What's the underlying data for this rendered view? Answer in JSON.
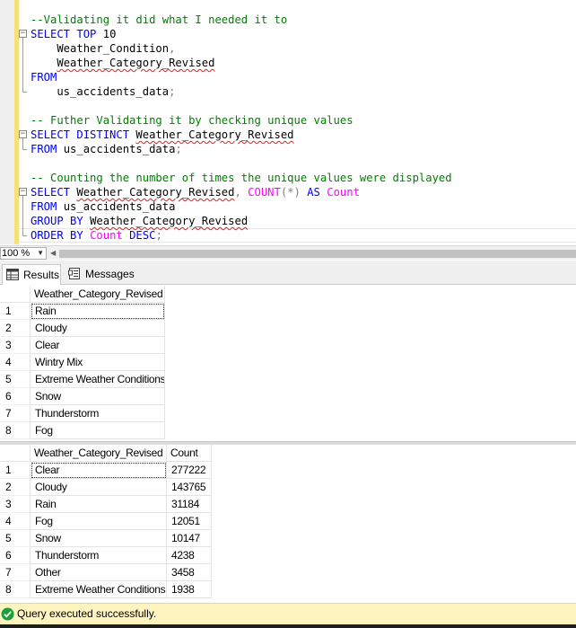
{
  "editor": {
    "lines": [
      {
        "segments": [
          {
            "t": "--Validating it did what I needed it to",
            "c": "cm"
          }
        ]
      },
      {
        "segments": [
          {
            "t": "SELECT",
            "c": "kw"
          },
          {
            "t": " "
          },
          {
            "t": "TOP",
            "c": "kw"
          },
          {
            "t": " 10"
          }
        ]
      },
      {
        "segments": [
          {
            "t": "    Weather_Condition"
          },
          {
            "t": ",",
            "c": "op"
          }
        ]
      },
      {
        "segments": [
          {
            "t": "    "
          },
          {
            "t": "Weather_Category_Revised",
            "c": "sq"
          }
        ]
      },
      {
        "segments": [
          {
            "t": "FROM",
            "c": "kw"
          }
        ]
      },
      {
        "segments": [
          {
            "t": "    us_accidents_data"
          },
          {
            "t": ";",
            "c": "op"
          }
        ]
      },
      {
        "segments": [
          {
            "t": ""
          }
        ]
      },
      {
        "segments": [
          {
            "t": "-- Futher Validating it by checking unique values",
            "c": "cm"
          }
        ]
      },
      {
        "segments": [
          {
            "t": "SELECT",
            "c": "kw"
          },
          {
            "t": " "
          },
          {
            "t": "DISTINCT",
            "c": "kw"
          },
          {
            "t": " "
          },
          {
            "t": "Weather_Category_Revised",
            "c": "sq"
          }
        ]
      },
      {
        "segments": [
          {
            "t": "FROM",
            "c": "kw"
          },
          {
            "t": " us_accidents_data"
          },
          {
            "t": ";",
            "c": "op"
          }
        ]
      },
      {
        "segments": [
          {
            "t": ""
          }
        ]
      },
      {
        "segments": [
          {
            "t": "-- Counting the number of times the unique values were displayed",
            "c": "cm"
          }
        ]
      },
      {
        "segments": [
          {
            "t": "SELECT",
            "c": "kw"
          },
          {
            "t": " "
          },
          {
            "t": "Weather_Category_Revised",
            "c": "sq"
          },
          {
            "t": ",",
            "c": "op"
          },
          {
            "t": " "
          },
          {
            "t": "COUNT",
            "c": "fn"
          },
          {
            "t": "(*)",
            "c": "op"
          },
          {
            "t": " "
          },
          {
            "t": "AS",
            "c": "kw"
          },
          {
            "t": " "
          },
          {
            "t": "Count",
            "c": "fn"
          }
        ]
      },
      {
        "segments": [
          {
            "t": "FROM",
            "c": "kw"
          },
          {
            "t": " us_accidents_data"
          }
        ]
      },
      {
        "segments": [
          {
            "t": "GROUP",
            "c": "kw"
          },
          {
            "t": " "
          },
          {
            "t": "BY",
            "c": "kw"
          },
          {
            "t": " "
          },
          {
            "t": "Weather_Category_Revised",
            "c": "sq"
          }
        ]
      },
      {
        "segments": [
          {
            "t": "ORDER",
            "c": "kw"
          },
          {
            "t": " "
          },
          {
            "t": "BY",
            "c": "kw"
          },
          {
            "t": " "
          },
          {
            "t": "Count",
            "c": "fn"
          },
          {
            "t": " "
          },
          {
            "t": "DESC",
            "c": "kw"
          },
          {
            "t": ";",
            "c": "op"
          }
        ]
      }
    ],
    "fold_symbol": "−"
  },
  "zoom": {
    "value": "100 %",
    "arrow": "▼",
    "scroll_left": "◀"
  },
  "tabs": {
    "results": "Results",
    "messages": "Messages"
  },
  "grid1": {
    "headers": [
      "Weather_Category_Revised"
    ],
    "rows": [
      {
        "num": "1",
        "cells": [
          "Rain"
        ]
      },
      {
        "num": "2",
        "cells": [
          "Cloudy"
        ]
      },
      {
        "num": "3",
        "cells": [
          "Clear"
        ]
      },
      {
        "num": "4",
        "cells": [
          "Wintry Mix"
        ]
      },
      {
        "num": "5",
        "cells": [
          "Extreme Weather Conditions"
        ]
      },
      {
        "num": "6",
        "cells": [
          "Snow"
        ]
      },
      {
        "num": "7",
        "cells": [
          "Thunderstorm"
        ]
      },
      {
        "num": "8",
        "cells": [
          "Fog"
        ]
      }
    ]
  },
  "grid2": {
    "headers": [
      "Weather_Category_Revised",
      "Count"
    ],
    "rows": [
      {
        "num": "1",
        "cells": [
          "Clear",
          "277222"
        ]
      },
      {
        "num": "2",
        "cells": [
          "Cloudy",
          "143765"
        ]
      },
      {
        "num": "3",
        "cells": [
          "Rain",
          "31184"
        ]
      },
      {
        "num": "4",
        "cells": [
          "Fog",
          "12051"
        ]
      },
      {
        "num": "5",
        "cells": [
          "Snow",
          "10147"
        ]
      },
      {
        "num": "6",
        "cells": [
          "Thunderstorm",
          "4238"
        ]
      },
      {
        "num": "7",
        "cells": [
          "Other",
          "3458"
        ]
      },
      {
        "num": "8",
        "cells": [
          "Extreme Weather Conditions",
          "1938"
        ]
      }
    ]
  },
  "status": {
    "text": "Query executed successfully.",
    "icon": "success-check-icon"
  },
  "colors": {
    "keyword": "#0000ff",
    "comment": "#008000",
    "function": "#ff00ff",
    "status_bg": "#fdf4bf",
    "success": "#1e9e3a"
  }
}
